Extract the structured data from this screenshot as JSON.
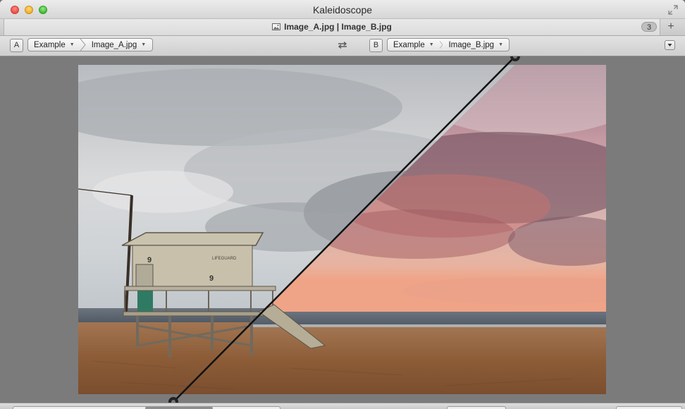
{
  "window": {
    "title": "Kaleidoscope"
  },
  "tab": {
    "title": "Image_A.jpg | Image_B.jpg",
    "count": "3",
    "add_icon": "plus-icon",
    "file_icon": "image-file-icon"
  },
  "pathbar": {
    "side_a_label": "A",
    "side_a_folder": "Example",
    "side_a_file": "Image_A.jpg",
    "side_b_label": "B",
    "side_b_folder": "Example",
    "side_b_file": "Image_B.jpg",
    "swap_icon": "swap-arrows-icon",
    "options_icon": "dropdown-menu-icon"
  },
  "comparison": {
    "mode": "split",
    "left_image": "Image_A.jpg",
    "right_image": "Image_B.jpg",
    "divider_handle_icon": "circle-handle-icon"
  },
  "colors": {
    "sky_a": "#c7c9cc",
    "sky_b": "#c48b93",
    "sunset": "#e7a38e",
    "sand": "#8d5d3a",
    "ocean": "#5d6670"
  }
}
